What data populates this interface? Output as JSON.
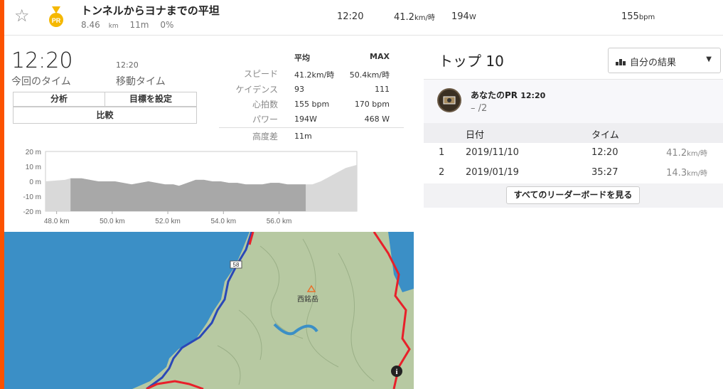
{
  "colors": {
    "accent": "#fc5200",
    "medal": "#f5b800",
    "route": "#e8202a",
    "track": "#2a48b8",
    "water": "#3b8fc6",
    "land": "#b7c9a2"
  },
  "segment": {
    "favorite_icon": "star-outline-icon",
    "medal_icon": "pr-medal-icon",
    "medal_label": "PR",
    "name": "トンネルからヨナまでの平坦",
    "distance": "8.46",
    "distance_unit": "km",
    "elev_gain": "11m",
    "grade": "0%",
    "time": "12:20",
    "speed": "41.2",
    "speed_unit": "km/時",
    "power": "194",
    "power_unit": "W",
    "hr": "155",
    "hr_unit": "bpm"
  },
  "effort": {
    "time": "12:20",
    "time_label": "今回のタイム",
    "moving_time": "12:20",
    "moving_time_label": "移動タイム",
    "analysis_button": "分析",
    "goal_button": "目標を設定",
    "compare_button": "比較"
  },
  "stats": {
    "avg_header": "平均",
    "max_header": "MAX",
    "rows": [
      {
        "label": "スピード",
        "avg": "41.2km/時",
        "max": "50.4km/時"
      },
      {
        "label": "ケイデンス",
        "avg": "93",
        "max": "111"
      },
      {
        "label": "心拍数",
        "avg": "155 bpm",
        "max": "170 bpm"
      },
      {
        "label": "パワー",
        "avg": "194W",
        "max": "468 W"
      },
      {
        "label": "高度差",
        "avg": "11m",
        "max": ""
      }
    ]
  },
  "chart_data": {
    "type": "area",
    "xlabel": "",
    "ylabel": "",
    "ylim": [
      -20,
      20
    ],
    "y_ticks": [
      "20 m",
      "10 m",
      "0 m",
      "-10 m",
      "-20 m"
    ],
    "x_ticks": [
      "48.0 km",
      "50.0 km",
      "52.0 km",
      "54.0 km",
      "56.0 km"
    ],
    "xlim": [
      47.6,
      58.8
    ],
    "highlight_range_km": [
      48.5,
      56.96
    ],
    "series": [
      {
        "x": [
          47.6,
          48.3,
          48.5,
          48.9,
          49.2,
          49.5,
          49.8,
          50.1,
          50.4,
          50.7,
          51.0,
          51.3,
          51.6,
          51.9,
          52.2,
          52.4,
          52.7,
          53.0,
          53.3,
          53.6,
          53.9,
          54.2,
          54.5,
          54.8,
          55.1,
          55.4,
          55.7,
          56.0,
          56.3,
          56.6,
          56.96,
          57.2,
          57.5,
          57.8,
          58.1,
          58.4,
          58.8
        ],
        "values": [
          0,
          1,
          2,
          2,
          1,
          0,
          0,
          0,
          -1,
          -2,
          -1,
          0,
          -1,
          -2,
          -2,
          -3,
          -1,
          1,
          1,
          0,
          0,
          -1,
          -1,
          -2,
          -2,
          -2,
          -1,
          -1,
          -2,
          -2,
          -2,
          -2,
          0,
          3,
          6,
          9,
          11
        ]
      }
    ]
  },
  "map": {
    "peak_label": "西銘岳",
    "road_shield": "58",
    "info_icon": "info-icon",
    "peak_icon": "mountain-peak-icon"
  },
  "top10": {
    "title": "トップ 10",
    "dropdown_icon": "bar-chart-icon",
    "dropdown_label": "自分の結果",
    "dropdown_caret": "caret-down-icon",
    "pr_title": "あなたのPR",
    "pr_time": "12:20",
    "pr_rank": "– /2",
    "col_date": "日付",
    "col_time": "タイム",
    "rows": [
      {
        "rank": "1",
        "date": "2019/11/10",
        "time": "12:20",
        "speed": "41.2",
        "speed_unit": "km/時"
      },
      {
        "rank": "2",
        "date": "2019/01/19",
        "time": "35:27",
        "speed": "14.3",
        "speed_unit": "km/時"
      }
    ],
    "view_all_button": "すべてのリーダーボードを見る"
  }
}
